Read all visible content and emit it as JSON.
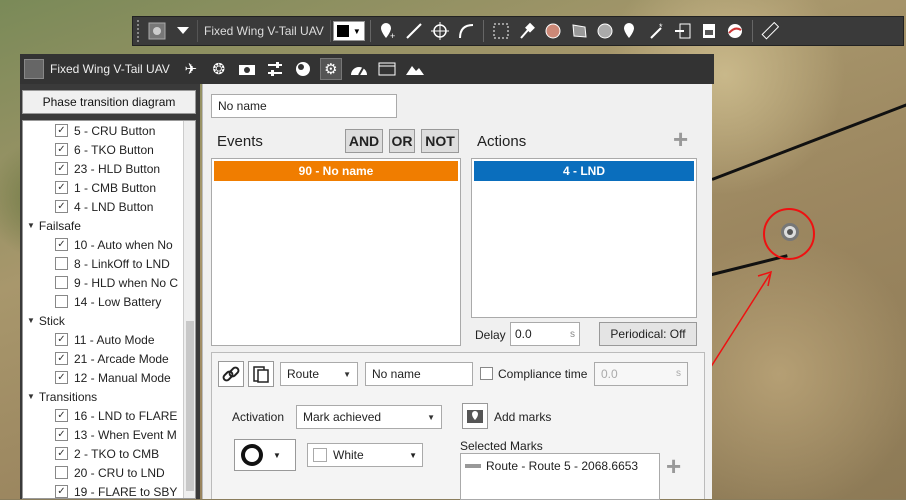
{
  "toolbar": {
    "title": "Fixed Wing V-Tail UAV",
    "icons": [
      "settings-gear-icon",
      "dropdown-arrow-icon",
      "color-swatch",
      "add-waypoint-icon",
      "line-icon",
      "crosshair-icon",
      "arc-icon",
      "selection-box-icon",
      "pin-icon",
      "circle-hatch-icon",
      "polygon-icon",
      "circle-fill-icon",
      "map-marker-icon",
      "magic-wand-icon",
      "export-icon",
      "doc-export-icon",
      "globe-icon",
      "ruler-icon"
    ]
  },
  "left_panel": {
    "header_title": "Fixed Wing V-Tail UAV",
    "phase_button": "Phase transition diagram",
    "tree": [
      {
        "type": "item",
        "label": "5 - CRU Button",
        "checked": true
      },
      {
        "type": "item",
        "label": "6 - TKO Button",
        "checked": true
      },
      {
        "type": "item",
        "label": "23 - HLD Button",
        "checked": true
      },
      {
        "type": "item",
        "label": "1 - CMB Button",
        "checked": true
      },
      {
        "type": "item",
        "label": "4 - LND Button",
        "checked": true
      },
      {
        "type": "group",
        "label": "Failsafe"
      },
      {
        "type": "item",
        "label": "10 - Auto when No",
        "checked": true
      },
      {
        "type": "item",
        "label": "8 - LinkOff to LND",
        "checked": false
      },
      {
        "type": "item",
        "label": "9 - HLD when No C",
        "checked": false
      },
      {
        "type": "item",
        "label": "14 - Low Battery",
        "checked": false
      },
      {
        "type": "group",
        "label": "Stick"
      },
      {
        "type": "item",
        "label": "11 - Auto Mode",
        "checked": true
      },
      {
        "type": "item",
        "label": "21 - Arcade Mode",
        "checked": true
      },
      {
        "type": "item",
        "label": "12 - Manual Mode",
        "checked": true
      },
      {
        "type": "group",
        "label": "Transitions"
      },
      {
        "type": "item",
        "label": "16 - LND to FLARE",
        "checked": true
      },
      {
        "type": "item",
        "label": "13 - When Event M",
        "checked": true
      },
      {
        "type": "item",
        "label": "2 - TKO to CMB",
        "checked": true
      },
      {
        "type": "item",
        "label": "20 - CRU to LND",
        "checked": false
      },
      {
        "type": "item",
        "label": "19 - FLARE to SBY",
        "checked": true
      }
    ]
  },
  "tabs": [
    "airplane-icon",
    "joystick-icon",
    "camera-icon",
    "sliders-icon",
    "globe-icon",
    "gears-icon",
    "gauge-icon",
    "window-icon",
    "mountains-icon"
  ],
  "main": {
    "name_value": "No name",
    "events_label": "Events",
    "and_label": "AND",
    "or_label": "OR",
    "not_label": "NOT",
    "actions_label": "Actions",
    "event_item": "90 - No name",
    "action_item": "4 - LND",
    "delay_label": "Delay",
    "delay_value": "0.0",
    "delay_unit": "s",
    "periodic_label": "Periodical: Off",
    "event_color": "#f07d00",
    "action_color": "#0a6ebd"
  },
  "action_config": {
    "type_value": "Route",
    "name_value": "No name",
    "compliance_label": "Compliance time",
    "compliance_value": "0.0",
    "compliance_unit": "s",
    "activation_label": "Activation",
    "activation_value": "Mark achieved",
    "add_marks_label": "Add marks",
    "color_value": "White",
    "selected_marks_label": "Selected Marks",
    "mark_item": "Route - Route 5 - 2068.6653"
  }
}
